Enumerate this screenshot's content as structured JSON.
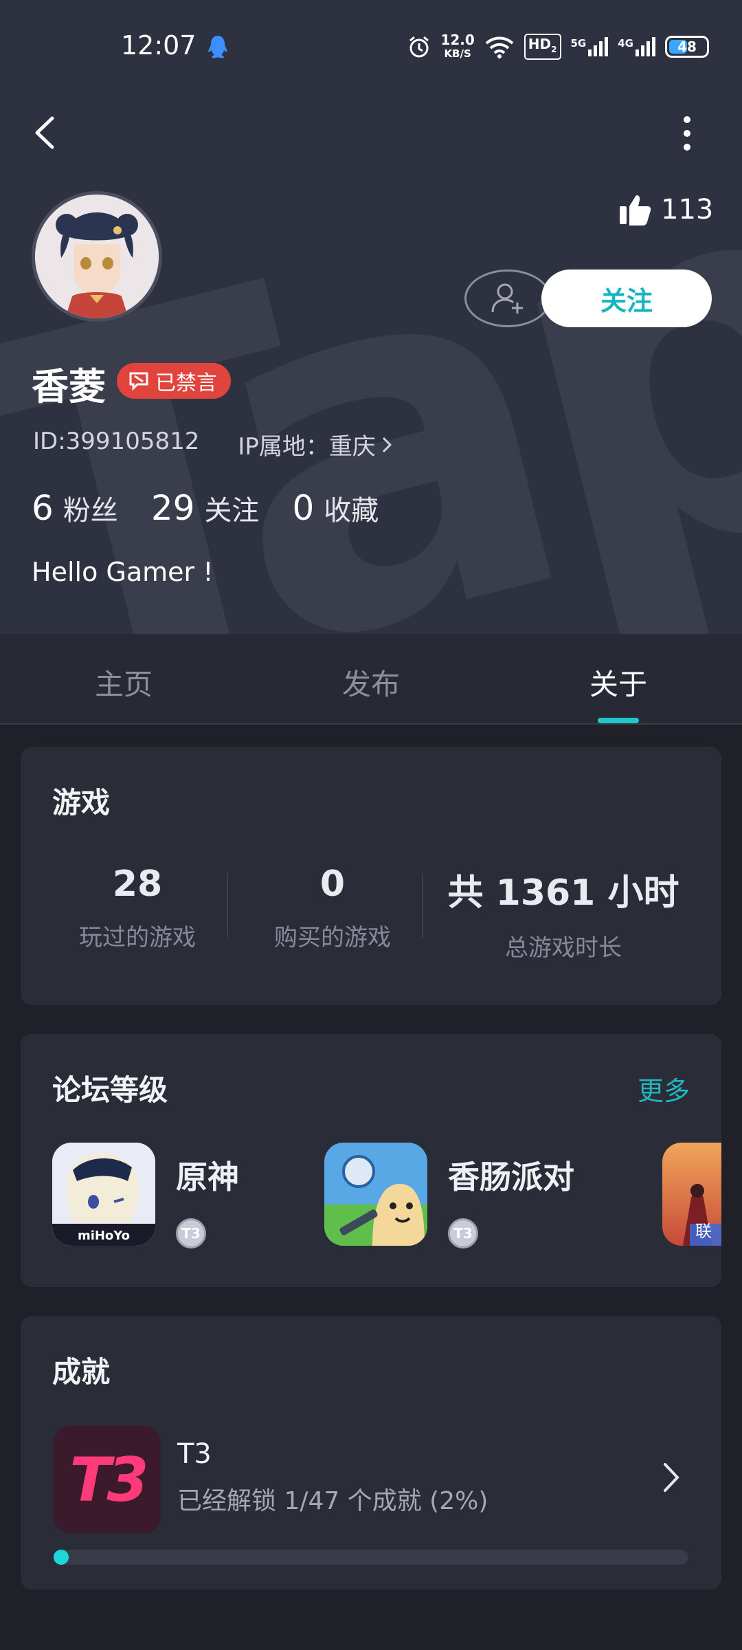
{
  "status_bar": {
    "time": "12:07",
    "net_speed_value": "12.0",
    "net_speed_unit": "KB/S",
    "hd_label": "HD",
    "hd_sub": "2",
    "sig1_label": "5G",
    "sig2_label": "4G",
    "battery": "48",
    "icons": [
      "qq-penguin-icon",
      "alarm-icon",
      "wifi-icon",
      "signal-5g-icon",
      "signal-4g-icon",
      "battery-icon"
    ]
  },
  "profile": {
    "likes": "113",
    "follow_label": "关注",
    "name": "香菱",
    "muted_label": "已禁言",
    "id_text": "ID:399105812",
    "ip_text": "IP属地：重庆",
    "stats": [
      {
        "value": "6",
        "label": "粉丝"
      },
      {
        "value": "29",
        "label": "关注"
      },
      {
        "value": "0",
        "label": "收藏"
      }
    ],
    "bio": "Hello Gamer !"
  },
  "tabs": [
    {
      "label": "主页",
      "active": false
    },
    {
      "label": "发布",
      "active": false
    },
    {
      "label": "关于",
      "active": true
    }
  ],
  "games_card": {
    "title": "游戏",
    "stats": [
      {
        "value": "28",
        "label": "玩过的游戏"
      },
      {
        "value": "0",
        "label": "购买的游戏"
      },
      {
        "value": "共 1361 小时",
        "label": "总游戏时长"
      }
    ]
  },
  "forum_card": {
    "title": "论坛等级",
    "more_label": "更多",
    "items": [
      {
        "name": "原神",
        "level": "T3",
        "icon_text": "miHoYo"
      },
      {
        "name": "香肠派对",
        "level": "T3"
      },
      {
        "name": "",
        "level": "",
        "icon_text": "联"
      }
    ]
  },
  "achievements_card": {
    "title": "成就",
    "game": "T3",
    "icon_text": "T3",
    "progress_text": "已经解锁 1/47 个成就 (2%)",
    "progress": 0.02
  },
  "colors": {
    "accent": "#21c6cc",
    "badge_red": "#e0443c",
    "header_bg": "#2e3140",
    "page_bg": "#1f2028",
    "card_bg": "#2a2c38"
  }
}
